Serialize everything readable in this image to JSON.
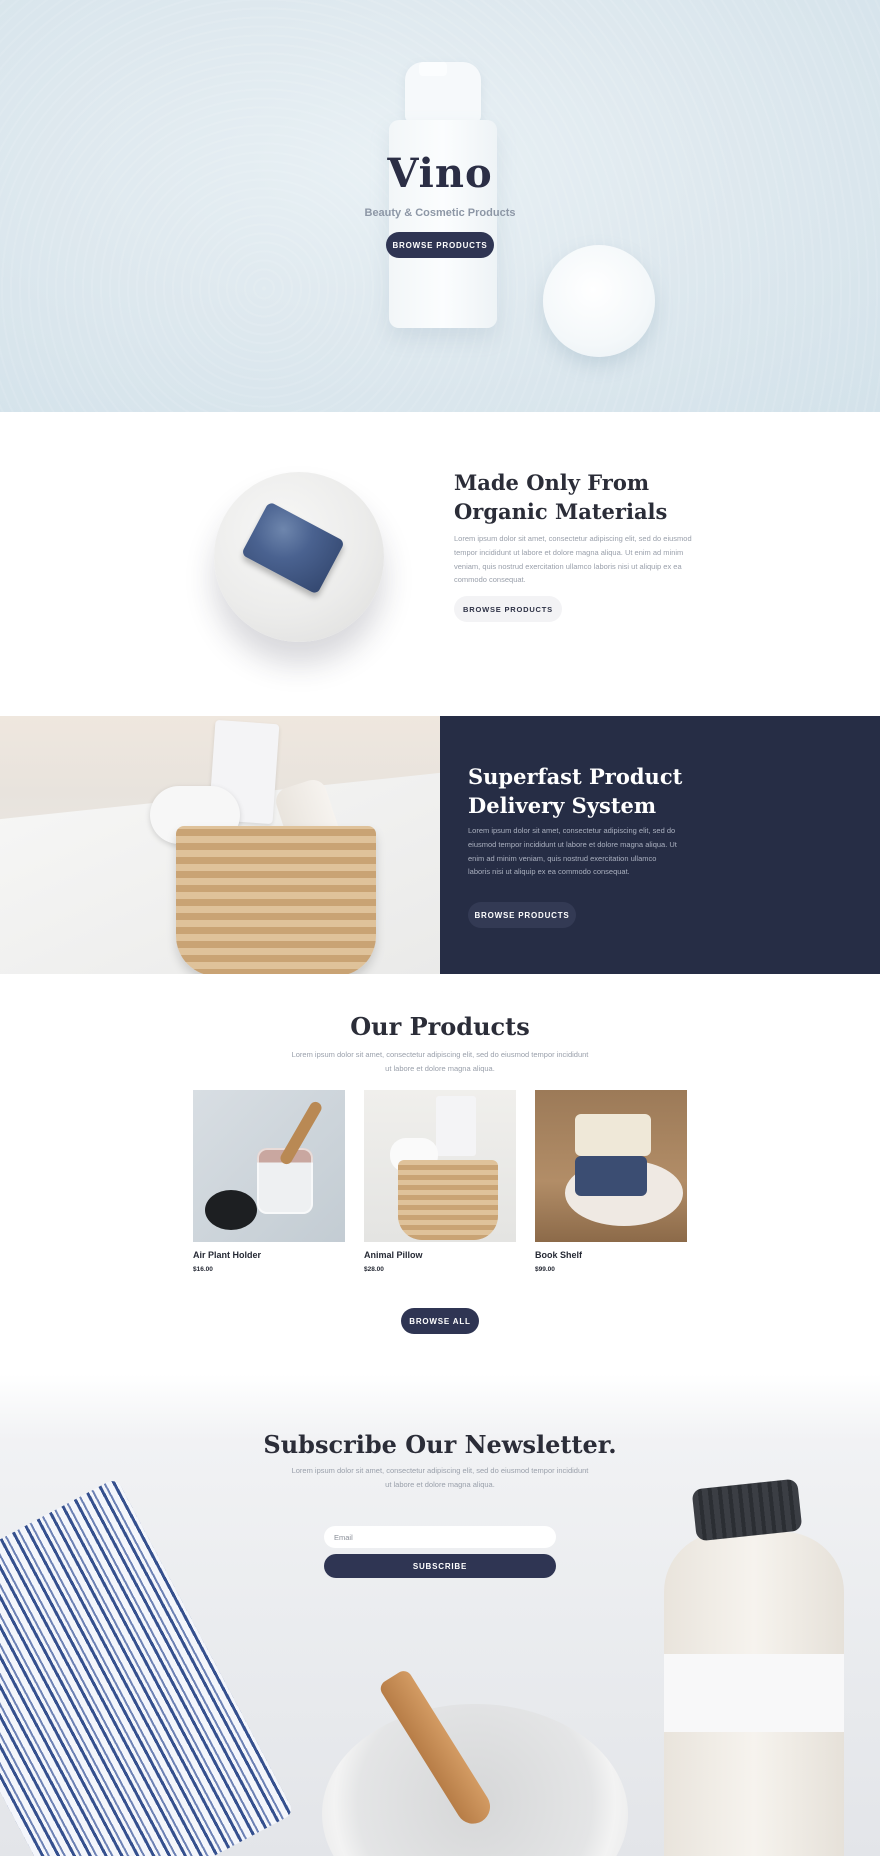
{
  "hero": {
    "title": "Vino",
    "subtitle": "Beauty & Cosmetic Products",
    "button": "BROWSE PRODUCTS"
  },
  "organic": {
    "title_line1": "Made Only From",
    "title_line2": "Organic Materials",
    "text": "Lorem ipsum dolor sit amet, consectetur adipiscing elit, sed do eiusmod tempor incididunt ut labore et dolore magna aliqua. Ut enim ad minim veniam, quis nostrud exercitation ullamco laboris nisi ut aliquip ex ea commodo consequat.",
    "button": "BROWSE PRODUCTS"
  },
  "delivery": {
    "title_line1": "Superfast Product",
    "title_line2": "Delivery System",
    "text": "Lorem ipsum dolor sit amet, consectetur adipiscing elit, sed do eiusmod tempor incididunt ut labore et dolore magna aliqua. Ut enim ad minim veniam, quis nostrud exercitation ullamco laboris nisi ut aliquip ex ea commodo consequat.",
    "button": "BROWSE PRODUCTS"
  },
  "products": {
    "title": "Our Products",
    "text": "Lorem ipsum dolor sit amet, consectetur adipiscing elit, sed do eiusmod tempor incididunt ut labore et dolore magna aliqua.",
    "items": [
      {
        "name": "Air Plant Holder",
        "price": "$16.00"
      },
      {
        "name": "Animal Pillow",
        "price": "$28.00"
      },
      {
        "name": "Book Shelf",
        "price": "$99.00"
      }
    ],
    "browse_all": "BROWSE ALL"
  },
  "newsletter": {
    "title": "Subscribe Our Newsletter.",
    "text": "Lorem ipsum dolor sit amet, consectetur adipiscing elit, sed do eiusmod tempor incididunt ut labore et dolore magna aliqua.",
    "email_placeholder": "Email",
    "button": "SUBSCRIBE"
  },
  "colors": {
    "navy": "#262d45",
    "button_dark": "#2f3553",
    "hero_bg": "#dfe9ef"
  }
}
